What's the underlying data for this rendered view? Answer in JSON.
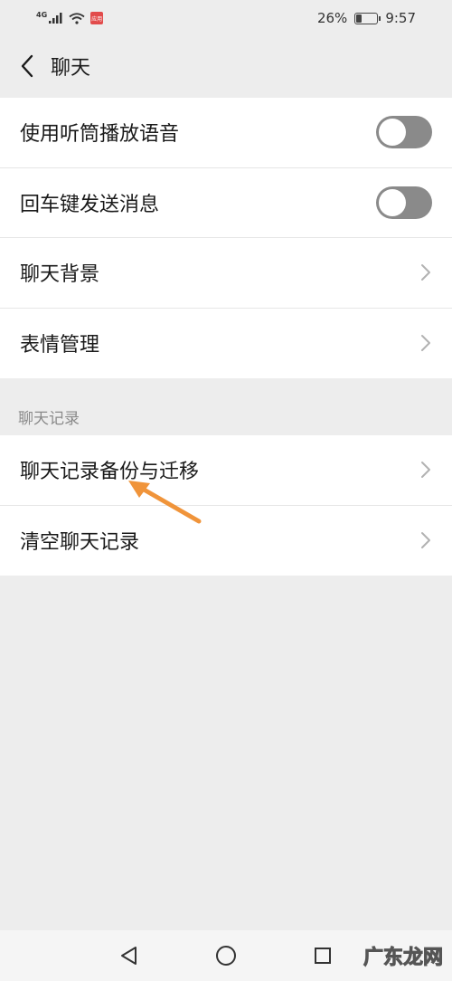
{
  "status_bar": {
    "signal_label": "4G",
    "app_badge": "应用",
    "battery_percent_text": "26%",
    "battery_level": 0.26,
    "time": "9:57"
  },
  "header": {
    "title": "聊天"
  },
  "settings_group_1": [
    {
      "label": "使用听筒播放语音",
      "control": "toggle",
      "on": false
    },
    {
      "label": "回车键发送消息",
      "control": "toggle",
      "on": false
    },
    {
      "label": "聊天背景",
      "control": "chevron"
    },
    {
      "label": "表情管理",
      "control": "chevron"
    }
  ],
  "section": {
    "title": "聊天记录"
  },
  "settings_group_2": [
    {
      "label": "聊天记录备份与迁移",
      "control": "chevron"
    },
    {
      "label": "清空聊天记录",
      "control": "chevron"
    }
  ],
  "annotation": {
    "color": "#f0943a"
  },
  "watermark": "广东龙网",
  "colors": {
    "background": "#ededed",
    "toggle_off": "#8a8a8a"
  }
}
